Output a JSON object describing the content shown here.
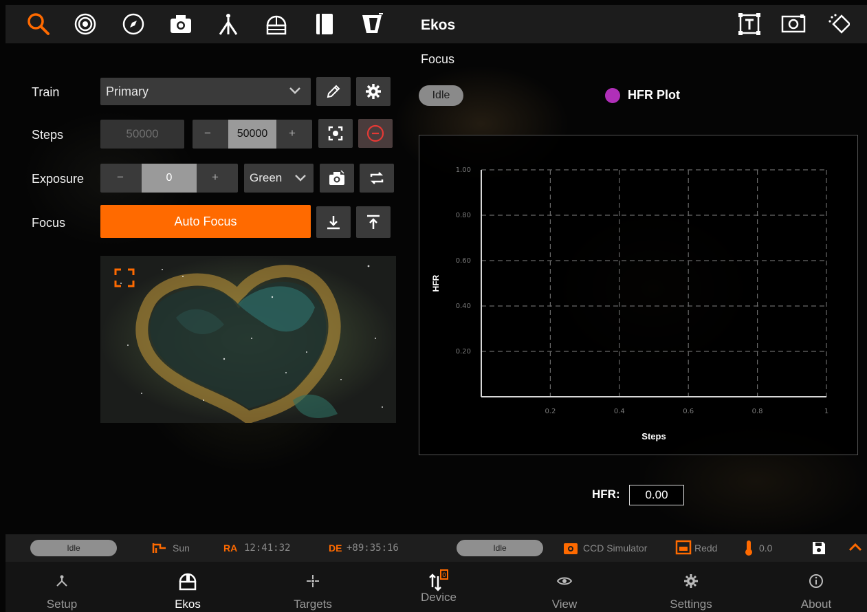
{
  "header": {
    "title": "Ekos"
  },
  "controls": {
    "train": {
      "label": "Train",
      "value": "Primary"
    },
    "steps": {
      "label": "Steps",
      "current": "50000",
      "target": "50000",
      "minus": "−",
      "plus": "+"
    },
    "exposure": {
      "label": "Exposure",
      "value": "0",
      "minus": "−",
      "plus": "+",
      "filter": "Green"
    },
    "focus": {
      "label": "Focus",
      "button": "Auto Focus"
    }
  },
  "focus_panel": {
    "title": "Focus",
    "status": "Idle",
    "legend": "HFR Plot",
    "hfr_label": "HFR:",
    "hfr_value": "0.00"
  },
  "chart_data": {
    "type": "line",
    "title": "",
    "xlabel": "Steps",
    "ylabel": "HFR",
    "series": [
      {
        "name": "HFR Plot",
        "values": []
      }
    ],
    "xlim": [
      0,
      1
    ],
    "ylim": [
      0,
      1
    ],
    "x_ticks": [
      "0.2",
      "0.4",
      "0.6",
      "0.8",
      "1"
    ],
    "y_ticks": [
      "1.00",
      "0.80",
      "0.60",
      "0.40",
      "0.20"
    ],
    "grid": true,
    "legend": "top",
    "series_color": "#b02fb8"
  },
  "status_bar": {
    "mount_status": "Idle",
    "target": "Sun",
    "ra_label": "RA",
    "ra_value": "12:41:32",
    "de_label": "DE",
    "de_value": "+89:35:16",
    "camera_status": "Idle",
    "camera": "CCD Simulator",
    "filter": "Redd",
    "temperature": "0.0"
  },
  "nav": {
    "items": [
      {
        "label": "Setup",
        "icon": "setup-icon"
      },
      {
        "label": "Ekos",
        "icon": "observatory-icon"
      },
      {
        "label": "Targets",
        "icon": "targets-icon"
      },
      {
        "label": "Device",
        "icon": "device-icon"
      },
      {
        "label": "View",
        "icon": "eye-icon"
      },
      {
        "label": "Settings",
        "icon": "gear-icon"
      },
      {
        "label": "About",
        "icon": "info-icon"
      }
    ]
  },
  "colors": {
    "accent": "#ff6a00",
    "panel": "#3a3a3a",
    "legend": "#b02fb8"
  }
}
